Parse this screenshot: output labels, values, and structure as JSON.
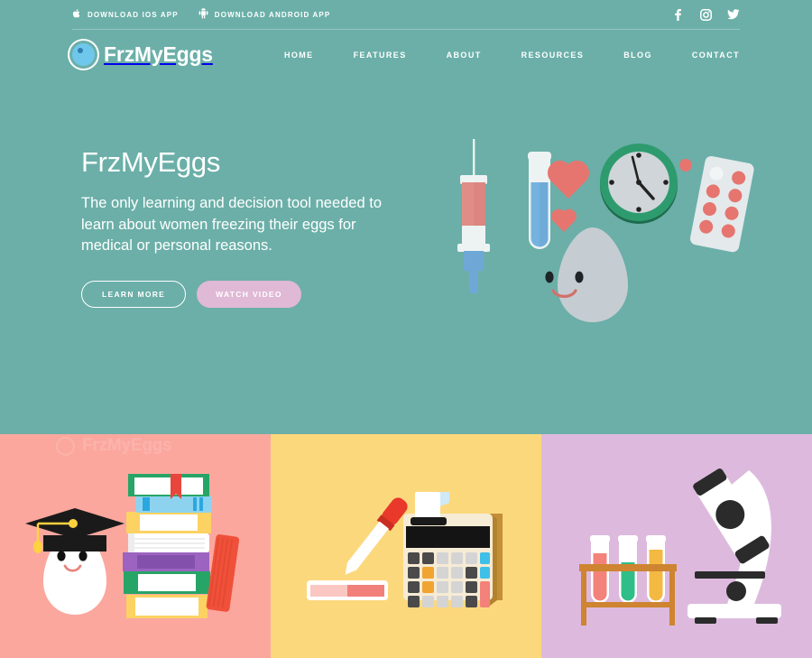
{
  "topbar": {
    "downloads": [
      {
        "label": "DOWNLOAD IOS APP",
        "icon": "apple-icon",
        "glyph": ""
      },
      {
        "label": "DOWNLOAD ANDROID APP",
        "icon": "android-icon",
        "glyph": "●"
      }
    ],
    "social": [
      {
        "name": "facebook-icon",
        "label": "Facebook"
      },
      {
        "name": "instagram-icon",
        "label": "Instagram"
      },
      {
        "name": "twitter-icon",
        "label": "Twitter"
      }
    ]
  },
  "brand": {
    "name": "FrzMyEggs",
    "mark": "egg-circle-logo"
  },
  "nav": {
    "items": [
      {
        "label": "HOME"
      },
      {
        "label": "FEATURES"
      },
      {
        "label": "ABOUT"
      },
      {
        "label": "RESOURCES"
      },
      {
        "label": "BLOG"
      },
      {
        "label": "CONTACT"
      }
    ]
  },
  "hero": {
    "title": "FrzMyEggs",
    "subtitle": "The only learning and decision tool needed to learn about women freezing their eggs for medical or personal reasons.",
    "primary_button": "LEARN MORE",
    "secondary_button": "WATCH VIDEO",
    "illustration": [
      "syringe-icon",
      "test-tube-icon",
      "heart-large-icon",
      "heart-small-icon",
      "clock-icon",
      "pill-blister-pack-icon",
      "loose-pill-icon",
      "smiling-egg-character"
    ]
  },
  "panels": [
    {
      "name": "education-panel",
      "background": "#FBA79E",
      "watermark": "FrzMyEggs",
      "illustration": [
        "graduation-cap-egg-character",
        "book-stack-icon"
      ]
    },
    {
      "name": "cost-panel",
      "background": "#FCD87D",
      "illustration": [
        "pipette-dropper-icon",
        "microscope-slide-icon",
        "cash-register-icon"
      ]
    },
    {
      "name": "science-panel",
      "background": "#DDBADD",
      "illustration": [
        "test-tube-rack-icon",
        "microscope-icon"
      ]
    }
  ],
  "colors": {
    "teal": "#6BAFA8",
    "salmon": "#FBA79E",
    "yellow": "#FCD87D",
    "lavender": "#DDBADD",
    "pink_button": "#E0B9D6",
    "logo_blue": "#6FC7EC"
  }
}
